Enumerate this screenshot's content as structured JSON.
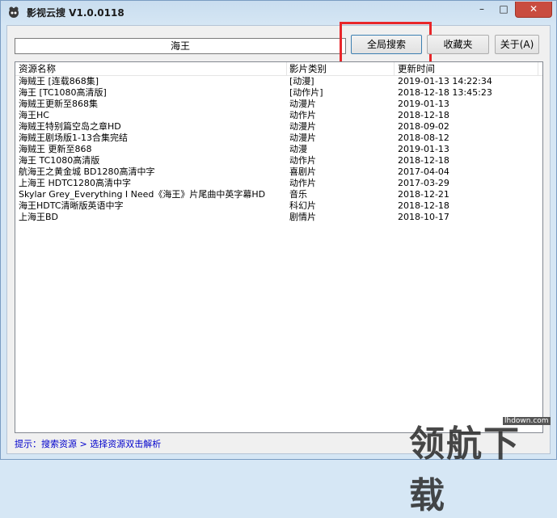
{
  "window": {
    "title": "影视云搜 V1.0.0118",
    "min_label": "–",
    "max_label": "□",
    "close_label": "✕"
  },
  "toolbar": {
    "search_value": "海王",
    "global_search_label": "全局搜索",
    "favorites_label": "收藏夹",
    "about_label": "关于(A)"
  },
  "list": {
    "columns": [
      "资源名称",
      "影片类别",
      "更新时间"
    ],
    "rows": [
      [
        "海贼王 [连载868集]",
        "[动漫]",
        "2019-01-13 14:22:34"
      ],
      [
        "海王 [TC1080高清版]",
        "[动作片]",
        "2018-12-18 13:45:23"
      ],
      [
        "海贼王更新至868集",
        "动漫片",
        "2019-01-13"
      ],
      [
        "海王HC",
        "动作片",
        "2018-12-18"
      ],
      [
        "海贼王特别篇空岛之章HD",
        "动漫片",
        "2018-09-02"
      ],
      [
        "海贼王剧场版1-13合集完结",
        "动漫片",
        "2018-08-12"
      ],
      [
        "海贼王 更新至868",
        "动漫",
        "2019-01-13"
      ],
      [
        "海王 TC1080高清版",
        "动作片",
        "2018-12-18"
      ],
      [
        "航海王之黄金城 BD1280高清中字",
        "喜剧片",
        "2017-04-04"
      ],
      [
        "上海王 HDTC1280高清中字",
        "动作片",
        "2017-03-29"
      ],
      [
        "Skylar Grey_Everything I Need《海王》片尾曲中英字幕HD",
        "音乐",
        "2018-12-21"
      ],
      [
        "海王HDTC清晰版英语中字",
        "科幻片",
        "2018-12-18"
      ],
      [
        "上海王BD",
        "剧情片",
        "2018-10-17"
      ]
    ]
  },
  "status": {
    "hint": "提示：搜索资源 > 选择资源双击解析"
  },
  "watermark": {
    "text": "领航下载",
    "url": "lhdown.com"
  }
}
